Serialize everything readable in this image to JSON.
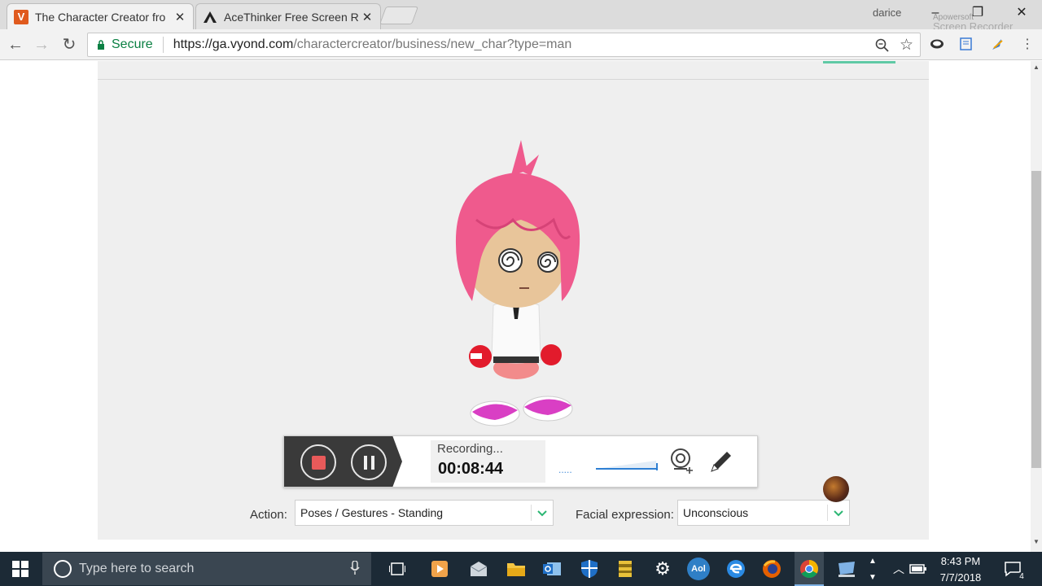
{
  "browser": {
    "tabs": [
      {
        "title": "The Character Creator fro",
        "icon": "vyond-v-icon",
        "active": true
      },
      {
        "title": "AceThinker Free Screen R",
        "icon": "acethinker-icon",
        "active": false
      }
    ],
    "profile_name": "darice",
    "watermark_brand": "Apowersoft",
    "watermark_product": "Screen Recorder",
    "secure_label": "Secure",
    "url_host": "https://ga.vyond.com",
    "url_path": "/charactercreator/business/new_char?type=man"
  },
  "recorder": {
    "status": "Recording...",
    "elapsed": "00:08:44",
    "dots": ".....",
    "stop_icon": "stop-icon",
    "pause_icon": "pause-icon"
  },
  "form": {
    "action_label": "Action:",
    "action_value": "Poses / Gestures - Standing",
    "facial_label": "Facial expression:",
    "facial_value": "Unconscious"
  },
  "taskbar": {
    "search_placeholder": "Type here to search",
    "time": "8:43 PM",
    "date": "7/7/2018",
    "notification_count": "4",
    "aol_label": "Aol"
  },
  "colors": {
    "accent_green": "#2bb673",
    "secure_green": "#0b8043",
    "stop_red": "#e85a5a",
    "taskbar_bg": "#1c2a36"
  }
}
